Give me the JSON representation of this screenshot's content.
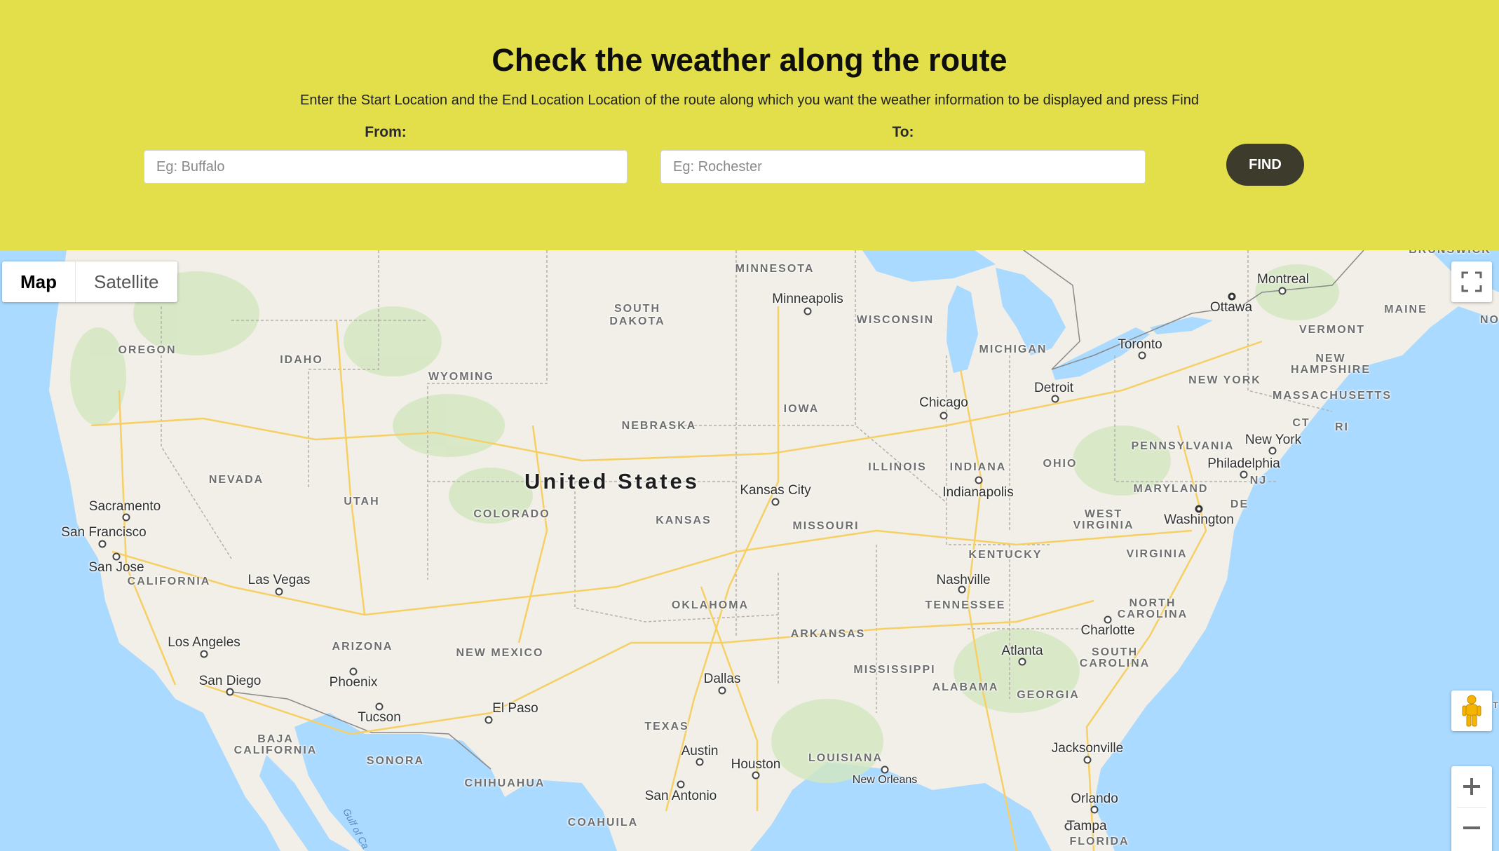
{
  "header": {
    "title": "Check the weather along the route",
    "subtitle": "Enter the Start Location and the End Location Location of the route along which you want the weather information to be displayed and press Find",
    "from_label": "From:",
    "from_placeholder": "Eg: Buffalo",
    "to_label": "To:",
    "to_placeholder": "Eg: Rochester",
    "find_label": "FIND"
  },
  "colors": {
    "header_bg": "#e2df4a",
    "find_button": "#3d3b2c",
    "water": "#aadaff",
    "land": "#f1efe7",
    "road": "#f8d776"
  },
  "map": {
    "map_type_options": [
      "Map",
      "Satellite"
    ],
    "selected_map_type": "Map",
    "controls": {
      "fullscreen_icon": "fullscreen-icon",
      "pegman_icon": "street-view-pegman-icon",
      "zoom_in_icon": "plus-icon",
      "zoom_out_icon": "minus-icon"
    },
    "country_label": "United States",
    "states": [
      "MINNESOTA",
      "SOUTH DAKOTA",
      "WISCONSIN",
      "MICHIGAN",
      "MAINE",
      "VERMONT",
      "NEW HAMPSHIRE",
      "MASSACHUSETTS",
      "CT",
      "RI",
      "NEW YORK",
      "PENNSYLVANIA",
      "OREGON",
      "IDAHO",
      "WYOMING",
      "NEBRASKA",
      "IOWA",
      "ILLINOIS",
      "INDIANA",
      "OHIO",
      "NEVADA",
      "UTAH",
      "COLORADO",
      "KANSAS",
      "MISSOURI",
      "KENTUCKY",
      "WEST VIRGINIA",
      "VIRGINIA",
      "MARYLAND",
      "NJ",
      "DE",
      "CALIFORNIA",
      "OKLAHOMA",
      "ARKANSAS",
      "TENNESSEE",
      "NORTH CAROLINA",
      "SOUTH CAROLINA",
      "ARIZONA",
      "NEW MEXICO",
      "MISSISSIPPI",
      "ALABAMA",
      "GEORGIA",
      "TEXAS",
      "LOUISIANA",
      "BAJA CALIFORNIA",
      "SONORA",
      "CHIHUAHUA",
      "COAHUILA",
      "FLORIDA",
      "BRUNSWICK"
    ],
    "cities": [
      "Minneapolis",
      "Montreal",
      "Ottawa",
      "Toronto",
      "Detroit",
      "Chicago",
      "New York",
      "Philadelphia",
      "Washington",
      "Kansas City",
      "Indianapolis",
      "Sacramento",
      "San Francisco",
      "San Jose",
      "Las Vegas",
      "Nashville",
      "Charlotte",
      "Los Angeles",
      "San Diego",
      "Phoenix",
      "Tucson",
      "El Paso",
      "Dallas",
      "Atlanta",
      "Austin",
      "Houston",
      "San Antonio",
      "New Orleans",
      "Jacksonville",
      "Orlando",
      "Tampa"
    ],
    "water_labels": [
      "Gulf of Ca"
    ],
    "edge_fragments": [
      "NO",
      "T"
    ]
  }
}
